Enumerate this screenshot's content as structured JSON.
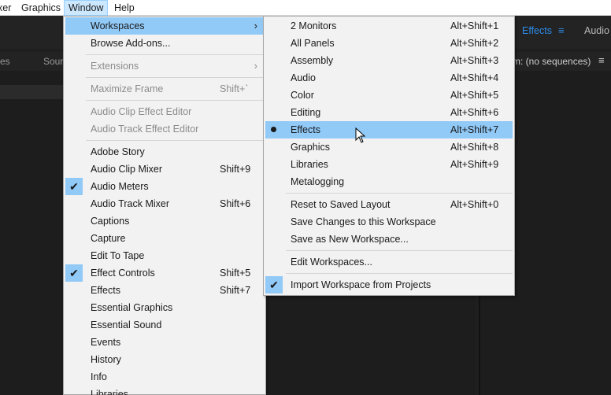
{
  "menubar": {
    "items": [
      {
        "label": "xer"
      },
      {
        "label": "Graphics"
      },
      {
        "label": "Window"
      },
      {
        "label": "Help"
      }
    ]
  },
  "app": {
    "tab_effects": "Effects",
    "tab_effects_menu_icon": "hamburger-menu-icon",
    "tab_audio": "Audio",
    "panel_left_tab": "es",
    "panel_left_tab2": "Sour",
    "program_panel": "m: (no sequences)",
    "program_menu_icon": "hamburger-menu-icon"
  },
  "window_menu": {
    "workspaces": {
      "label": "Workspaces",
      "arrow": "›"
    },
    "browse_addons": {
      "label": "Browse Add-ons..."
    },
    "extensions": {
      "label": "Extensions",
      "arrow": "›"
    },
    "maximize_frame": {
      "label": "Maximize Frame",
      "shortcut": "Shift+`"
    },
    "audio_clip_effect_editor": {
      "label": "Audio Clip Effect Editor"
    },
    "audio_track_effect_editor": {
      "label": "Audio Track Effect Editor"
    },
    "adobe_story": {
      "label": "Adobe Story"
    },
    "audio_clip_mixer": {
      "label": "Audio Clip Mixer",
      "shortcut": "Shift+9"
    },
    "audio_meters": {
      "label": "Audio Meters",
      "check": "✔"
    },
    "audio_track_mixer": {
      "label": "Audio Track Mixer",
      "shortcut": "Shift+6"
    },
    "captions": {
      "label": "Captions"
    },
    "capture": {
      "label": "Capture"
    },
    "edit_to_tape": {
      "label": "Edit To Tape"
    },
    "effect_controls": {
      "label": "Effect Controls",
      "shortcut": "Shift+5",
      "check": "✔"
    },
    "effects": {
      "label": "Effects",
      "shortcut": "Shift+7"
    },
    "essential_graphics": {
      "label": "Essential Graphics"
    },
    "essential_sound": {
      "label": "Essential Sound"
    },
    "events": {
      "label": "Events"
    },
    "history": {
      "label": "History"
    },
    "info": {
      "label": "Info"
    },
    "libraries": {
      "label": "Libraries"
    }
  },
  "workspaces_menu": {
    "two_monitors": {
      "label": "2 Monitors",
      "shortcut": "Alt+Shift+1"
    },
    "all_panels": {
      "label": "All Panels",
      "shortcut": "Alt+Shift+2"
    },
    "assembly": {
      "label": "Assembly",
      "shortcut": "Alt+Shift+3"
    },
    "audio": {
      "label": "Audio",
      "shortcut": "Alt+Shift+4"
    },
    "color": {
      "label": "Color",
      "shortcut": "Alt+Shift+5"
    },
    "editing": {
      "label": "Editing",
      "shortcut": "Alt+Shift+6"
    },
    "effects": {
      "label": "Effects",
      "shortcut": "Alt+Shift+7"
    },
    "graphics": {
      "label": "Graphics",
      "shortcut": "Alt+Shift+8"
    },
    "libraries": {
      "label": "Libraries",
      "shortcut": "Alt+Shift+9"
    },
    "metalogging": {
      "label": "Metalogging"
    },
    "reset_layout": {
      "label": "Reset to Saved Layout",
      "shortcut": "Alt+Shift+0"
    },
    "save_changes": {
      "label": "Save Changes to this Workspace"
    },
    "save_as_new": {
      "label": "Save as New Workspace..."
    },
    "edit_workspaces": {
      "label": "Edit Workspaces..."
    },
    "import_from_projects": {
      "label": "Import Workspace from Projects",
      "check": "✔"
    }
  },
  "colors": {
    "highlight": "#91c9f7",
    "menubar_active": "#cce8ff",
    "accent_blue": "#2d8ceb",
    "app_dark": "#232323"
  }
}
